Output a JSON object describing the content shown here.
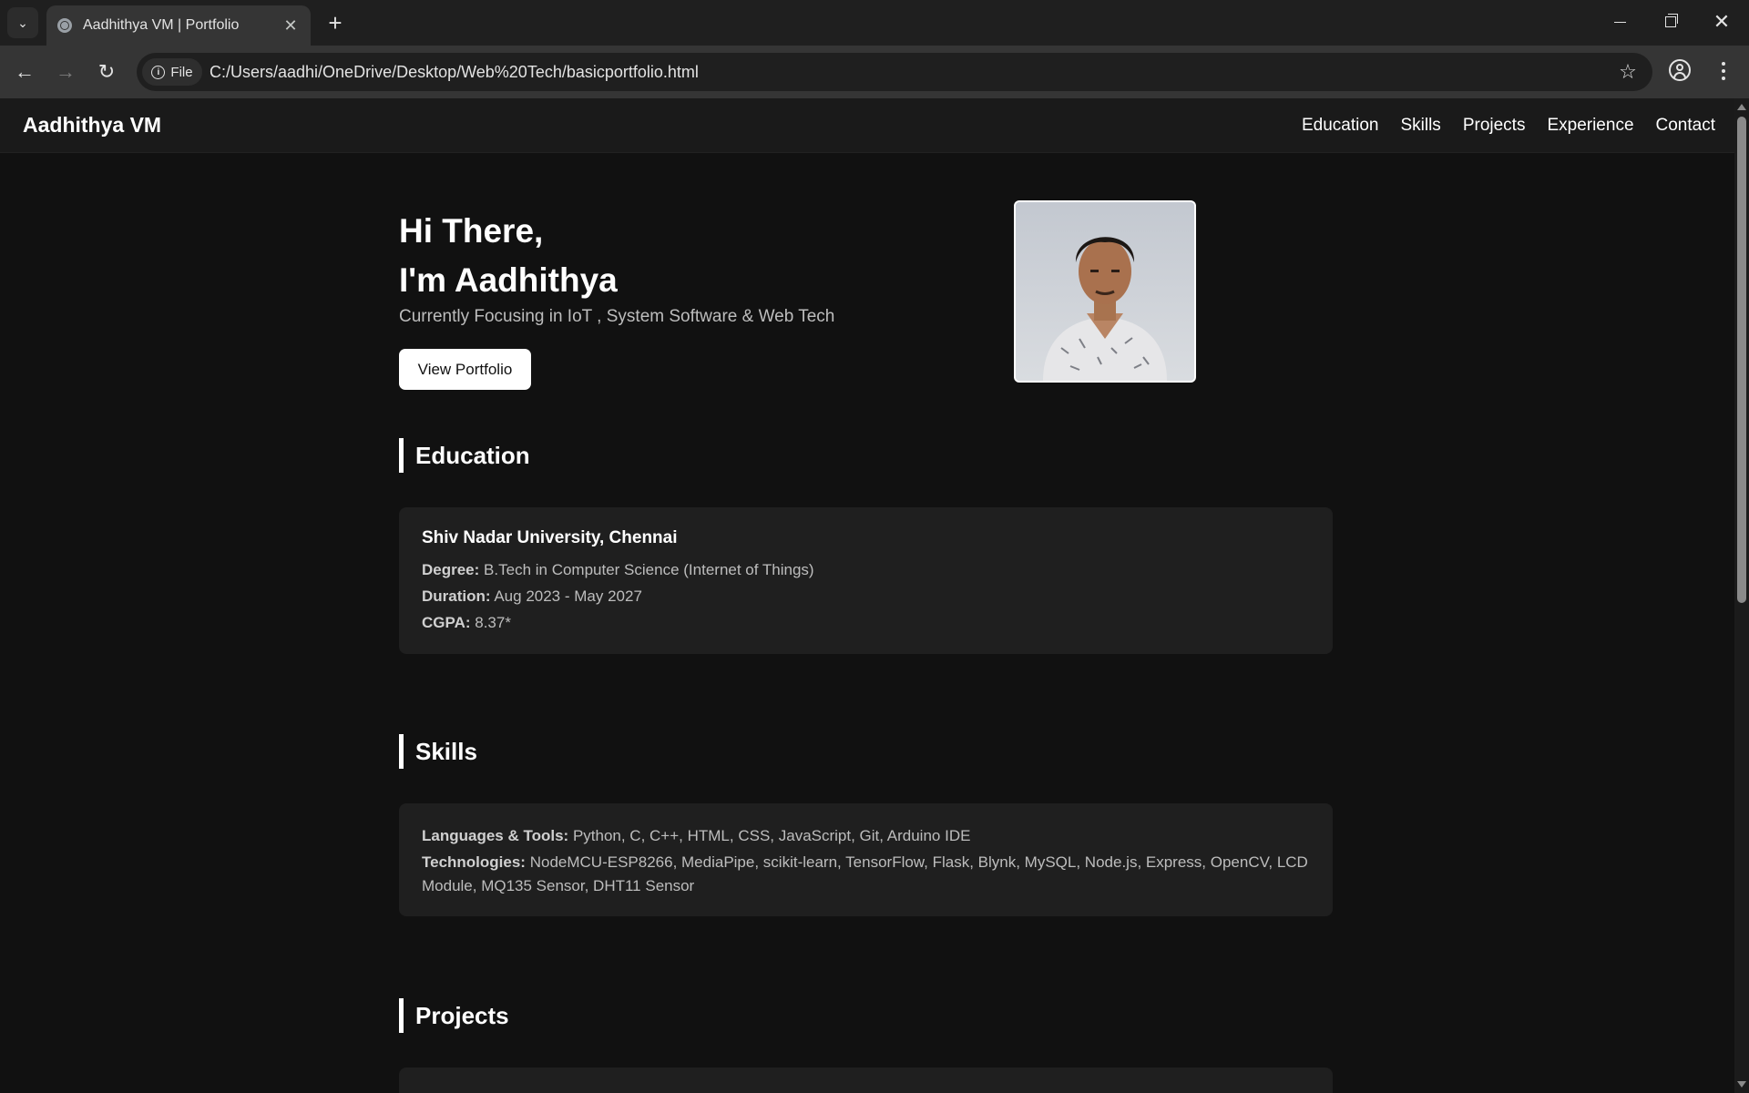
{
  "browser": {
    "tab_title": "Aadhithya VM | Portfolio",
    "site_chip": "File",
    "url": "C:/Users/aadhi/OneDrive/Desktop/Web%20Tech/basicportfolio.html"
  },
  "site": {
    "brand": "Aadhithya VM",
    "nav": [
      "Education",
      "Skills",
      "Projects",
      "Experience",
      "Contact"
    ]
  },
  "hero": {
    "greeting": "Hi There,",
    "name_line": "I'm Aadhithya",
    "subtitle": "Currently Focusing in IoT , System Software & Web Tech",
    "button": "View Portfolio"
  },
  "education": {
    "title": "Education",
    "institution": "Shiv Nadar University, Chennai",
    "degree_label": "Degree:",
    "degree": "B.Tech in Computer Science (Internet of Things)",
    "duration_label": "Duration:",
    "duration": "Aug 2023 - May 2027",
    "cgpa_label": "CGPA:",
    "cgpa": "8.37*"
  },
  "skills": {
    "title": "Skills",
    "languages_label": "Languages & Tools:",
    "languages": "Python, C, C++, HTML, CSS, JavaScript, Git, Arduino IDE",
    "technologies_label": "Technologies:",
    "technologies": "NodeMCU-ESP8266, MediaPipe, scikit-learn, TensorFlow, Flask, Blynk, MySQL, Node.js, Express, OpenCV, LCD Module, MQ135 Sensor, DHT11 Sensor"
  },
  "projects": {
    "title": "Projects"
  }
}
